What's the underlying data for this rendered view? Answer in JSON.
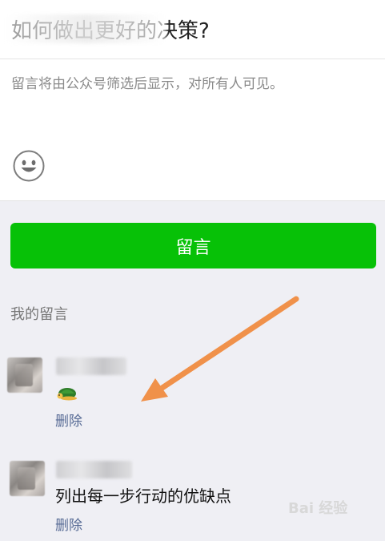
{
  "article": {
    "title": "如何做出更好的决策?"
  },
  "compose": {
    "placeholder": "留言将由公众号筛选后显示，对所有人可见。",
    "emoji_icon": "smiley-face-icon",
    "submit_label": "留言"
  },
  "my_comments": {
    "section_label": "我的留言",
    "items": [
      {
        "text": "",
        "has_emoji": true,
        "emoji_icon": "turtle-emoji-icon",
        "delete_label": "删除"
      },
      {
        "text": "列出每一步行动的优缺点",
        "has_emoji": false,
        "delete_label": "删除"
      }
    ]
  },
  "annotation": {
    "arrow_color": "#f0914a"
  },
  "colors": {
    "accent_green": "#07c107",
    "link_blue": "#576b95",
    "background": "#efeff4"
  },
  "watermark": {
    "text": "Bai 经验"
  }
}
